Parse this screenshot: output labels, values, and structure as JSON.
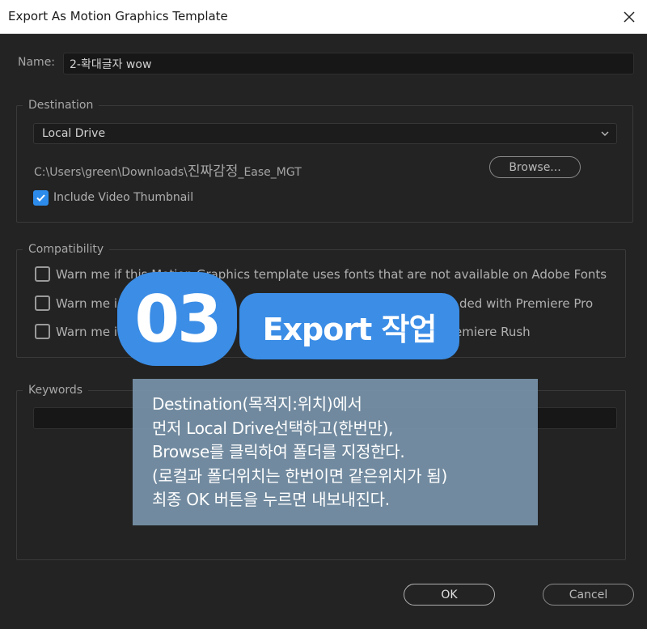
{
  "window": {
    "title": "Export As Motion Graphics Template"
  },
  "name_field": {
    "label": "Name:",
    "value": "2-확대글자 wow"
  },
  "destination": {
    "title": "Destination",
    "select_value": "Local Drive",
    "path_prefix": "C:\\Users\\green\\Downloads\\",
    "path_korean": "진짜감정",
    "path_suffix": "_Ease_MGT",
    "browse_label": "Browse...",
    "thumbnail_label": "Include Video Thumbnail"
  },
  "compatibility": {
    "title": "Compatibility",
    "items": [
      {
        "label": "Warn me if this Motion Graphics template uses fonts that are not available on Adobe Fonts"
      },
      {
        "label_left": "Warn me i",
        "label_right": "ded with Premiere Pro"
      },
      {
        "label_left": "Warn me i",
        "label_right": "emiere Rush"
      }
    ]
  },
  "keywords": {
    "title": "Keywords"
  },
  "overlay": {
    "badge_number": "03",
    "badge_text": "Export 작업",
    "lines": [
      "Destination(목적지:위치)에서",
      "먼저 Local Drive선택하고(한번만),",
      "Browse를 클릭하여 폴더를 지정한다.",
      "(로컬과 폴더위치는 한번이면 같은위치가 됨)",
      "최종 OK 버튼을 누르면 내보내진다."
    ]
  },
  "buttons": {
    "ok_label": "OK",
    "cancel_label": "Cancel"
  },
  "colors": {
    "accent": "#3b8de6",
    "checkbox_blue": "#2d8ceb"
  }
}
